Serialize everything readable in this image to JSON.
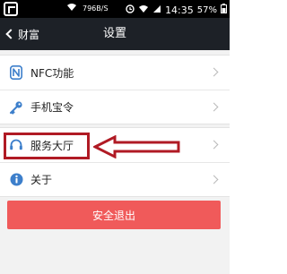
{
  "status_bar": {
    "speed": "796B/S",
    "time": "14:35",
    "battery": "57%"
  },
  "header": {
    "back_label": "财富",
    "title": "设置"
  },
  "settings": {
    "group1": [
      {
        "label": "NFC功能",
        "icon": "nfc-icon"
      },
      {
        "label": "手机宝令",
        "icon": "key-icon"
      }
    ],
    "group2": [
      {
        "label": "服务大厅",
        "icon": "headset-icon"
      },
      {
        "label": "关于",
        "icon": "info-icon"
      }
    ]
  },
  "logout_label": "安全退出",
  "colors": {
    "header_bg": "#1d2127",
    "accent_blue": "#3d7fcb",
    "logout_red": "#f05a5a",
    "annotation_red": "#b01a24"
  }
}
